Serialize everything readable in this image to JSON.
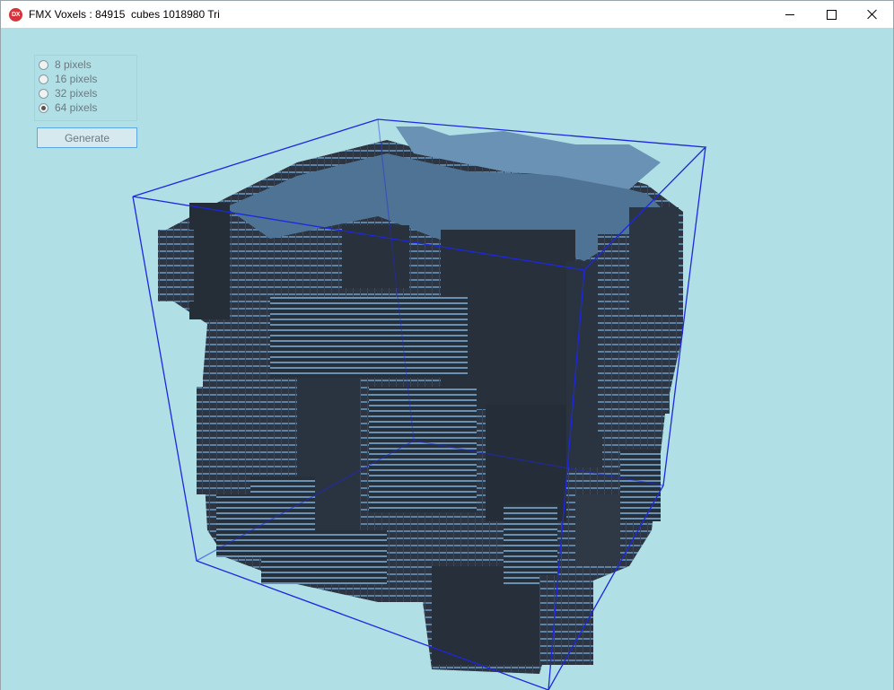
{
  "window": {
    "icon_text": "DX",
    "title": "FMX Voxels : 84915  cubes 1018980 Tri"
  },
  "options": {
    "items": [
      {
        "label": "8 pixels",
        "checked": false
      },
      {
        "label": "16 pixels",
        "checked": false
      },
      {
        "label": "32 pixels",
        "checked": false
      },
      {
        "label": "64 pixels",
        "checked": true
      }
    ]
  },
  "generate_button": {
    "label": "Generate"
  },
  "scene": {
    "background": "#b0dfe5",
    "voxel_dark": "#2b3440",
    "voxel_light": "#5f84a6",
    "bounding_box": "#1d27e0"
  }
}
